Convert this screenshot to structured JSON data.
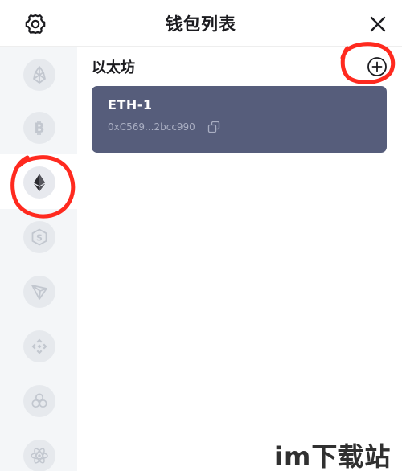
{
  "header": {
    "title": "钱包列表",
    "settings_icon": "gear-icon",
    "close_icon": "close-icon"
  },
  "sidebar": {
    "active_index": 2,
    "items": [
      {
        "icon": "eos-icon"
      },
      {
        "icon": "bitcoin-icon"
      },
      {
        "icon": "ethereum-icon"
      },
      {
        "icon": "swtc-icon"
      },
      {
        "icon": "tron-icon"
      },
      {
        "icon": "binance-icon"
      },
      {
        "icon": "cosmos-ring-icon"
      },
      {
        "icon": "atom-icon"
      }
    ]
  },
  "main": {
    "chain_title": "以太坊",
    "add_icon": "plus-circle-icon",
    "wallets": [
      {
        "name": "ETH-1",
        "address": "0xC569...2bcc990",
        "copy_icon": "copy-icon"
      }
    ]
  },
  "watermark": {
    "text": "im下载站"
  },
  "colors": {
    "card_bg": "#565d7b",
    "sidebar_bg": "#f4f6f8",
    "annotation_red": "#ff2a1f"
  }
}
